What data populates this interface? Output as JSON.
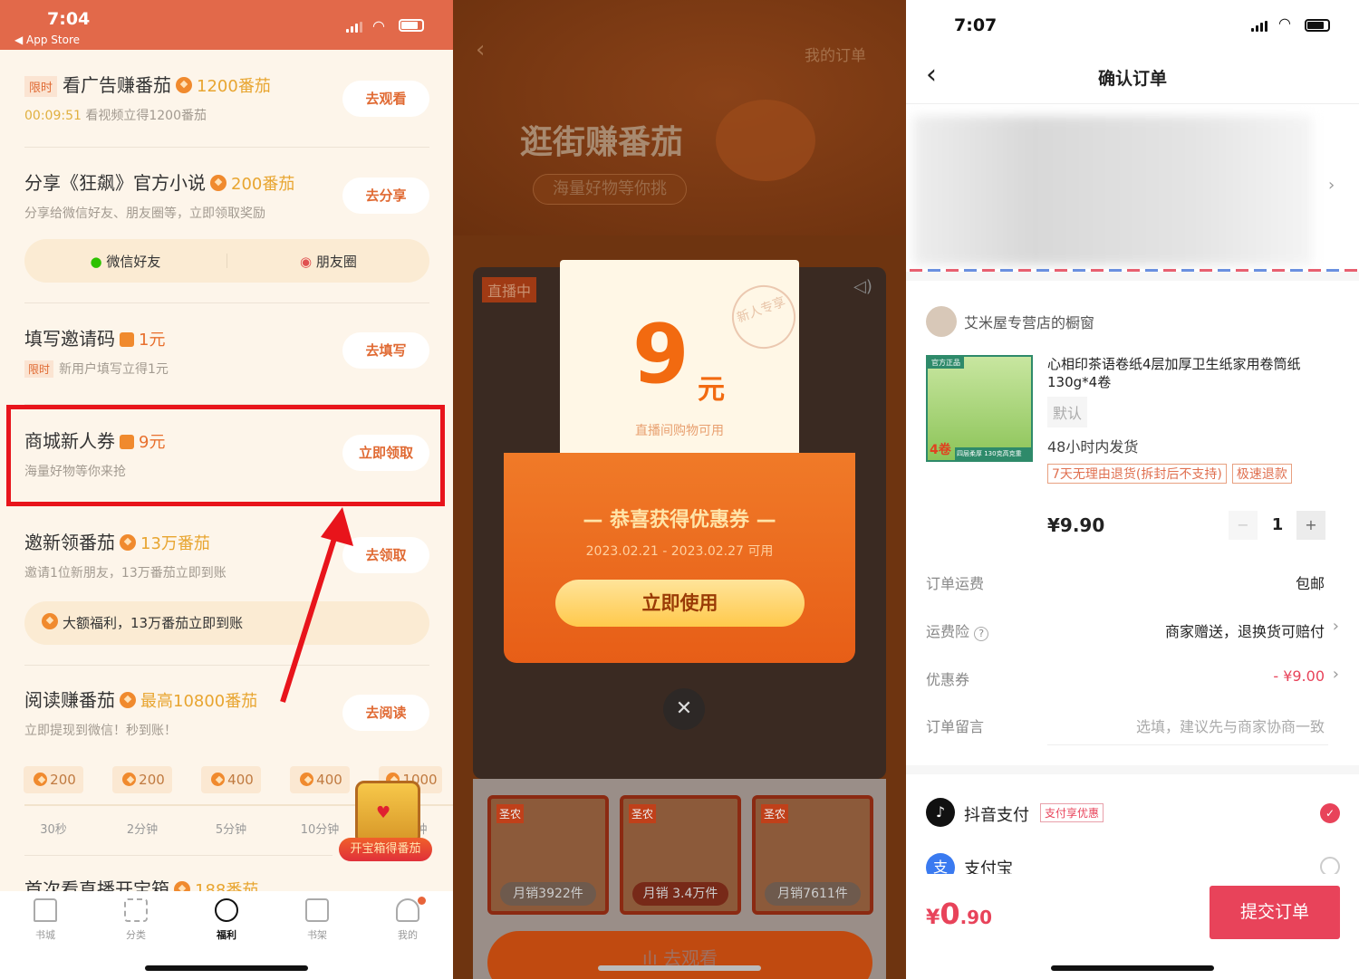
{
  "left": {
    "status": {
      "time": "7:04",
      "back_app": "◀ App Store"
    },
    "tasks": [
      {
        "tag": "限时",
        "title": "看广告赚番茄",
        "reward": "1200番茄",
        "countdown": "00:09:51",
        "sub": "看视频立得1200番茄",
        "button": "去观看"
      },
      {
        "title": "分享《狂飙》官方小说",
        "reward": "200番茄",
        "sub": "分享给微信好友、朋友圈等，立即领取奖励",
        "button": "去分享",
        "share": [
          "微信好友",
          "朋友圈"
        ]
      },
      {
        "title": "填写邀请码",
        "reward": "1元",
        "tag": "限时",
        "sub": "新用户填写立得1元",
        "button": "去填写"
      },
      {
        "title": "商城新人券",
        "reward": "9元",
        "sub": "海量好物等你来抢",
        "button": "立即领取"
      },
      {
        "title": "邀新领番茄",
        "reward": "13万番茄",
        "sub": "邀请1位新朋友，13万番茄立即到账",
        "button": "去领取",
        "banner": "大额福利，13万番茄立即到账"
      },
      {
        "title": "阅读赚番茄",
        "reward": "最高10800番茄",
        "sub": "立即提现到微信！秒到账！",
        "button": "去阅读"
      },
      {
        "title": "首次看直播开宝箱",
        "reward": "188番茄"
      }
    ],
    "steps": [
      {
        "value": "200",
        "label": "30秒"
      },
      {
        "value": "200",
        "label": "2分钟"
      },
      {
        "value": "400",
        "label": "5分钟"
      },
      {
        "value": "400",
        "label": "10分钟"
      },
      {
        "value": "1000",
        "label": "钟"
      }
    ],
    "chest_label": "开宝箱得番茄",
    "tabs": [
      {
        "label": "书城",
        "icon": "home-icon"
      },
      {
        "label": "分类",
        "icon": "grid-icon"
      },
      {
        "label": "福利",
        "icon": "coin-icon",
        "active": true
      },
      {
        "label": "书架",
        "icon": "book-icon"
      },
      {
        "label": "我的",
        "icon": "user-icon"
      }
    ],
    "highlight_color": "#E8141B"
  },
  "middle": {
    "my_orders": "我的订单",
    "banner_title": "逛街赚番茄",
    "banner_sub": "海量好物等你挑",
    "live_badge": "直播中",
    "coupon": {
      "amount": "9",
      "unit": "元",
      "note": "直播间购物可用",
      "stamp": "新人专享",
      "headline": "恭喜获得优惠券",
      "validity": "2023.02.21 - 2023.02.27 可用",
      "button": "立即使用"
    },
    "products": [
      {
        "brand": "圣农",
        "sales": "月销3922件"
      },
      {
        "brand": "圣农",
        "sales": "月销 3.4万件"
      },
      {
        "brand": "圣农",
        "sales": "月销7611件"
      }
    ],
    "watch_button": "去观看"
  },
  "right": {
    "status": {
      "time": "7:07"
    },
    "title": "确认订单",
    "shop": "艾米屋专营店的橱窗",
    "product": {
      "name": "心相印茶语卷纸4层加厚卫生纸家用卷筒纸130g*4卷",
      "spec": "默认",
      "ship": "48小时内发货",
      "badges": [
        "7天无理由退货(拆封后不支持)",
        "极速退款"
      ],
      "price": "¥9.90",
      "qty": "1",
      "image_text": [
        "官方正品",
        "4卷",
        "四层柔厚 130克高克重"
      ]
    },
    "rows": [
      {
        "label": "订单运费",
        "value": "包邮"
      },
      {
        "label": "运费险",
        "value": "商家赠送，退换货可赔付"
      },
      {
        "label": "优惠券",
        "value": "- ¥9.00"
      },
      {
        "label": "订单留言",
        "value": "选填，建议先与商家协商一致"
      }
    ],
    "payments": [
      {
        "name": "抖音支付",
        "badge": "支付享优惠",
        "selected": true
      },
      {
        "name": "支付宝",
        "selected": false
      }
    ],
    "total": {
      "symbol": "¥",
      "int": "0",
      "dec": ".90"
    },
    "submit": "提交订单",
    "accent": "#E8435A"
  }
}
